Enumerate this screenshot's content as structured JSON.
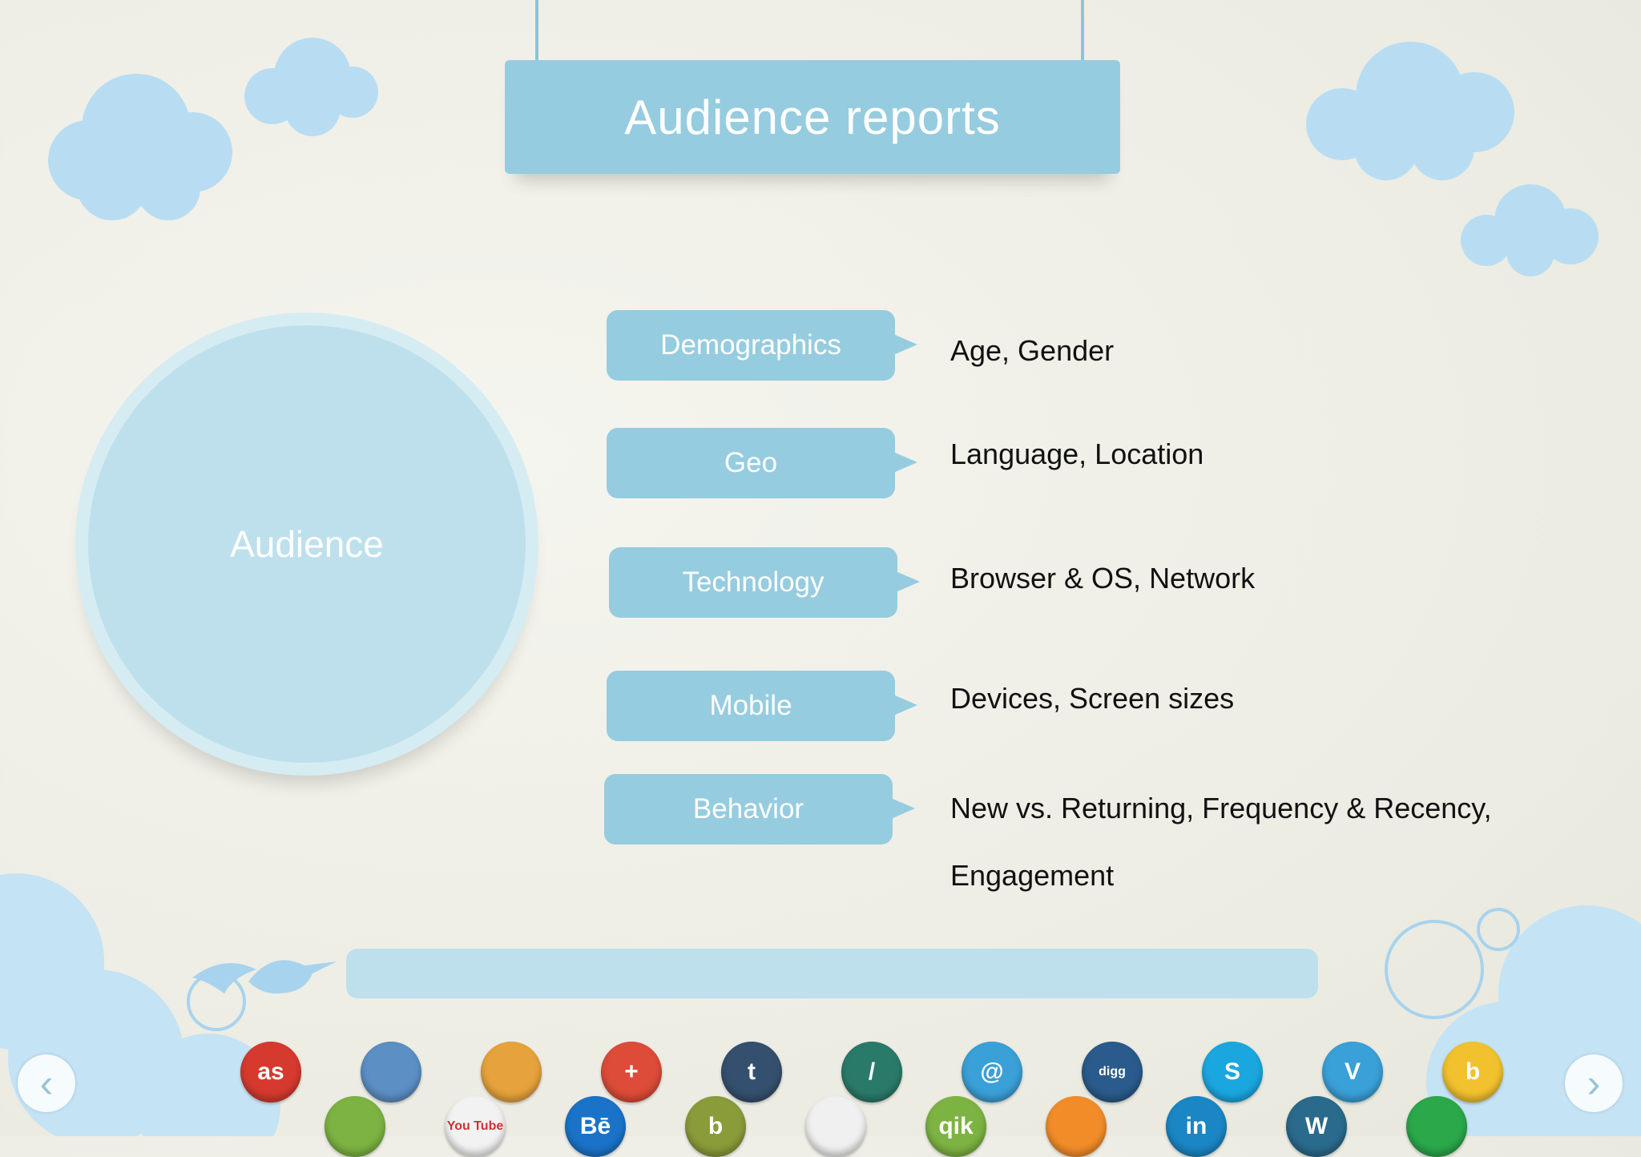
{
  "title": "Audience reports",
  "center": "Audience",
  "categories": [
    {
      "label": "Demographics",
      "detail": "Age, Gender"
    },
    {
      "label": "Geo",
      "detail": "Language, Location"
    },
    {
      "label": "Technology",
      "detail": "Browser & OS, Network"
    },
    {
      "label": "Mobile",
      "detail": "Devices, Screen sizes"
    },
    {
      "label": "Behavior",
      "detail": "New vs. Returning, Frequency & Recency, Engagement"
    }
  ],
  "nav": {
    "prev": "‹",
    "next": "›"
  },
  "badges": [
    {
      "icon": "lastfm-icon",
      "text": "as",
      "color": "#d63a2e"
    },
    {
      "icon": "evernote-icon",
      "text": "",
      "color": "#7cb342"
    },
    {
      "icon": "pencil-icon",
      "text": "",
      "color": "#5c8fc4"
    },
    {
      "icon": "youtube-icon",
      "text": "You Tube",
      "color": "#f2f2f2"
    },
    {
      "icon": "picasa-icon",
      "text": "",
      "color": "#e6a23c"
    },
    {
      "icon": "behance-icon",
      "text": "Bē",
      "color": "#1a73c9"
    },
    {
      "icon": "google-plus-icon",
      "text": "+",
      "color": "#dd4b39"
    },
    {
      "icon": "blogger-icon",
      "text": "b",
      "color": "#8a9b3a"
    },
    {
      "icon": "tumblr-icon",
      "text": "t",
      "color": "#35506e"
    },
    {
      "icon": "reddit-icon",
      "text": "",
      "color": "#f0f0f0"
    },
    {
      "icon": "slash-icon",
      "text": "/",
      "color": "#2a7a6a"
    },
    {
      "icon": "qik-icon",
      "text": "qik",
      "color": "#7cb342"
    },
    {
      "icon": "at-icon",
      "text": "@",
      "color": "#3aa0d8"
    },
    {
      "icon": "rss-icon",
      "text": "",
      "color": "#f28c28"
    },
    {
      "icon": "digg-icon",
      "text": "digg",
      "color": "#2a5b8c"
    },
    {
      "icon": "linkedin-icon",
      "text": "in",
      "color": "#1a86c4"
    },
    {
      "icon": "skype-icon",
      "text": "S",
      "color": "#1aa7e0"
    },
    {
      "icon": "wordpress-icon",
      "text": "W",
      "color": "#2a6a8c"
    },
    {
      "icon": "vimeo-icon",
      "text": "V",
      "color": "#3aa0d8"
    },
    {
      "icon": "share-icon",
      "text": "",
      "color": "#2aa84a"
    },
    {
      "icon": "bebo-icon",
      "text": "b",
      "color": "#f2c12e"
    }
  ]
}
